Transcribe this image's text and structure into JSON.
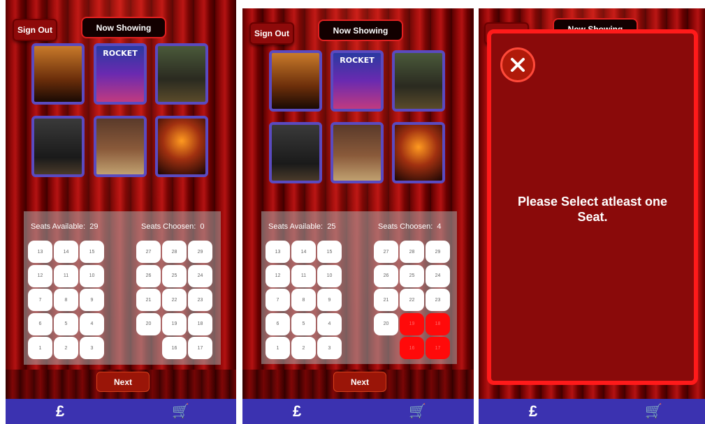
{
  "screens": [
    {
      "sign_out": "Sign Out",
      "now_showing": "Now Showing",
      "movies": [
        "",
        "ROCKET",
        "",
        "",
        "",
        ""
      ],
      "seats_available_label": "Seats Available:",
      "seats_available": "29",
      "seats_chosen_label": "Seats Choosen:",
      "seats_chosen": "0",
      "left_rows": [
        [
          "13",
          "14",
          "15"
        ],
        [
          "12",
          "11",
          "10"
        ],
        [
          "7",
          "8",
          "9"
        ],
        [
          "6",
          "5",
          "4"
        ],
        [
          "1",
          "2",
          "3"
        ]
      ],
      "right_rows": [
        [
          "27",
          "28",
          "29"
        ],
        [
          "26",
          "25",
          "24"
        ],
        [
          "21",
          "22",
          "23"
        ],
        [
          "20",
          "19",
          "18"
        ],
        [
          "",
          "16",
          "17"
        ]
      ],
      "selected_seats": [],
      "next": "Next"
    },
    {
      "sign_out": "Sign Out",
      "now_showing": "Now Showing",
      "movies": [
        "",
        "ROCKET",
        "",
        "",
        "",
        ""
      ],
      "seats_available_label": "Seats Available:",
      "seats_available": "25",
      "seats_chosen_label": "Seats Choosen:",
      "seats_chosen": "4",
      "left_rows": [
        [
          "13",
          "14",
          "15"
        ],
        [
          "12",
          "11",
          "10"
        ],
        [
          "7",
          "8",
          "9"
        ],
        [
          "6",
          "5",
          "4"
        ],
        [
          "1",
          "2",
          "3"
        ]
      ],
      "right_rows": [
        [
          "27",
          "28",
          "29"
        ],
        [
          "26",
          "25",
          "24"
        ],
        [
          "21",
          "22",
          "23"
        ],
        [
          "20",
          "19",
          "18"
        ],
        [
          "",
          "16",
          "17"
        ]
      ],
      "selected_seats": [
        "19",
        "18",
        "16",
        "17"
      ],
      "next": "Next"
    }
  ],
  "dialog": {
    "message": "Please Select atleast one Seat.",
    "background_title": "Now Showing"
  },
  "nav": {
    "items": [
      {
        "icon": "ticket-icon",
        "glyph": "£"
      },
      {
        "icon": "cart-icon",
        "glyph": "🛒"
      }
    ]
  },
  "colors": {
    "accent": "#ff1a1a",
    "nav": "#3b32b0",
    "seat_selected": "#ff0a0a"
  }
}
